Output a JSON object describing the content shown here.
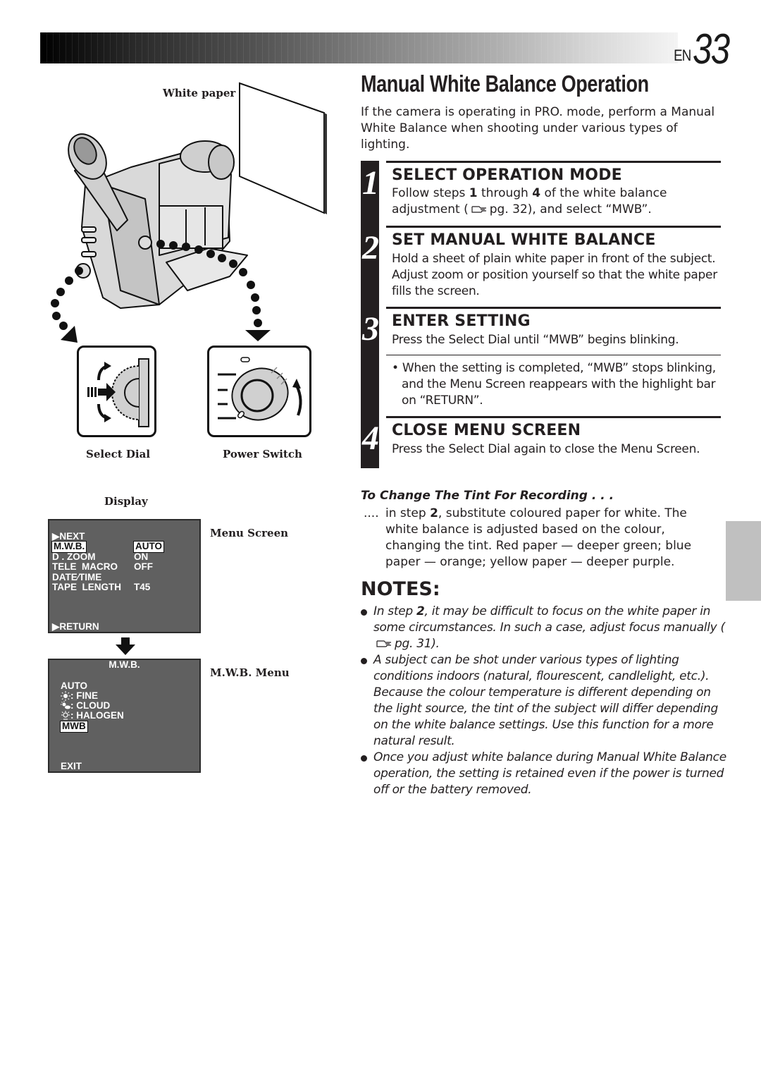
{
  "header": {
    "prefix": "EN",
    "page_number": "33"
  },
  "illustration": {
    "white_paper_label": "White paper",
    "select_dial_label": "Select Dial",
    "power_switch_label": "Power Switch",
    "display_label": "Display",
    "menu_screen_label": "Menu Screen",
    "mwb_menu_label": "M.W.B. Menu"
  },
  "menu_screen": {
    "rows": [
      {
        "label": "NEXT",
        "prefix": "▶",
        "value": ""
      },
      {
        "label": "M.W.B.",
        "value": "AUTO",
        "highlighted": true
      },
      {
        "label": "D . ZOOM",
        "value": "ON"
      },
      {
        "label": "TELE  MACRO",
        "value": "OFF"
      },
      {
        "label": "DATE⁄TIME",
        "value": ""
      },
      {
        "label": "TAPE  LENGTH",
        "value": "T45"
      }
    ],
    "footer": "▶RETURN"
  },
  "mwb_menu": {
    "title": "M.W.B.",
    "items": [
      {
        "label": "AUTO",
        "icon": ""
      },
      {
        "label": ": FINE",
        "icon": "sun-icon"
      },
      {
        "label": ": CLOUD",
        "icon": "cloud-icon"
      },
      {
        "label": ": HALOGEN",
        "icon": "halogen-icon"
      },
      {
        "label": "MWB",
        "icon": "",
        "highlighted": true
      }
    ],
    "footer": "EXIT"
  },
  "title": "Manual White Balance Operation",
  "intro": "If the camera is operating in PRO. mode, perform a Manual White Balance when shooting under various types of lighting.",
  "steps": [
    {
      "number": "1",
      "heading": "SELECT OPERATION MODE",
      "body_parts": [
        "Follow steps ",
        "1",
        " through ",
        "4",
        " of the white balance adjustment (",
        "pg. 32), and select “MWB”."
      ]
    },
    {
      "number": "2",
      "heading": "SET MANUAL WHITE BALANCE",
      "body": "Hold a sheet of plain white paper in front of the subject. Adjust zoom or position yourself so that the white paper fills the screen."
    },
    {
      "number": "3",
      "heading": "ENTER SETTING",
      "body": "Press the Select Dial until “MWB” begins blinking.",
      "note": "When the setting is completed, “MWB” stops blinking, and the Menu Screen reappears with the highlight bar on “RETURN”."
    },
    {
      "number": "4",
      "heading": "CLOSE MENU SCREEN",
      "body": "Press the Select Dial again to close the Menu Screen."
    }
  ],
  "tint": {
    "heading": "To Change The Tint For Recording . . .",
    "leader": "....",
    "body_parts": [
      "in step ",
      "2",
      ", substitute coloured paper for white. The white balance is adjusted based on the colour, changing the tint. Red paper — deeper green; blue paper — orange; yellow paper — deeper purple."
    ]
  },
  "notes": {
    "heading": "NOTES:",
    "items": [
      {
        "parts": [
          "In step ",
          "2",
          ", it may be difficult to focus on the white paper in some circumstances. In such a case, adjust focus manually (",
          "pg. 31)."
        ]
      },
      {
        "text": "A subject can be shot under various types of lighting conditions indoors (natural, flourescent, candlelight, etc.). Because the colour temperature is different depending on the light source, the tint of the subject will differ depending on the white balance settings. Use this function for a more natural result."
      },
      {
        "text": "Once you adjust white balance during Manual White Balance operation, the setting is retained even if the power is turned off or the battery removed."
      }
    ]
  },
  "colors": {
    "osd_background": "#606060",
    "side_tab": "#c0c0c0",
    "text": "#231f20"
  }
}
